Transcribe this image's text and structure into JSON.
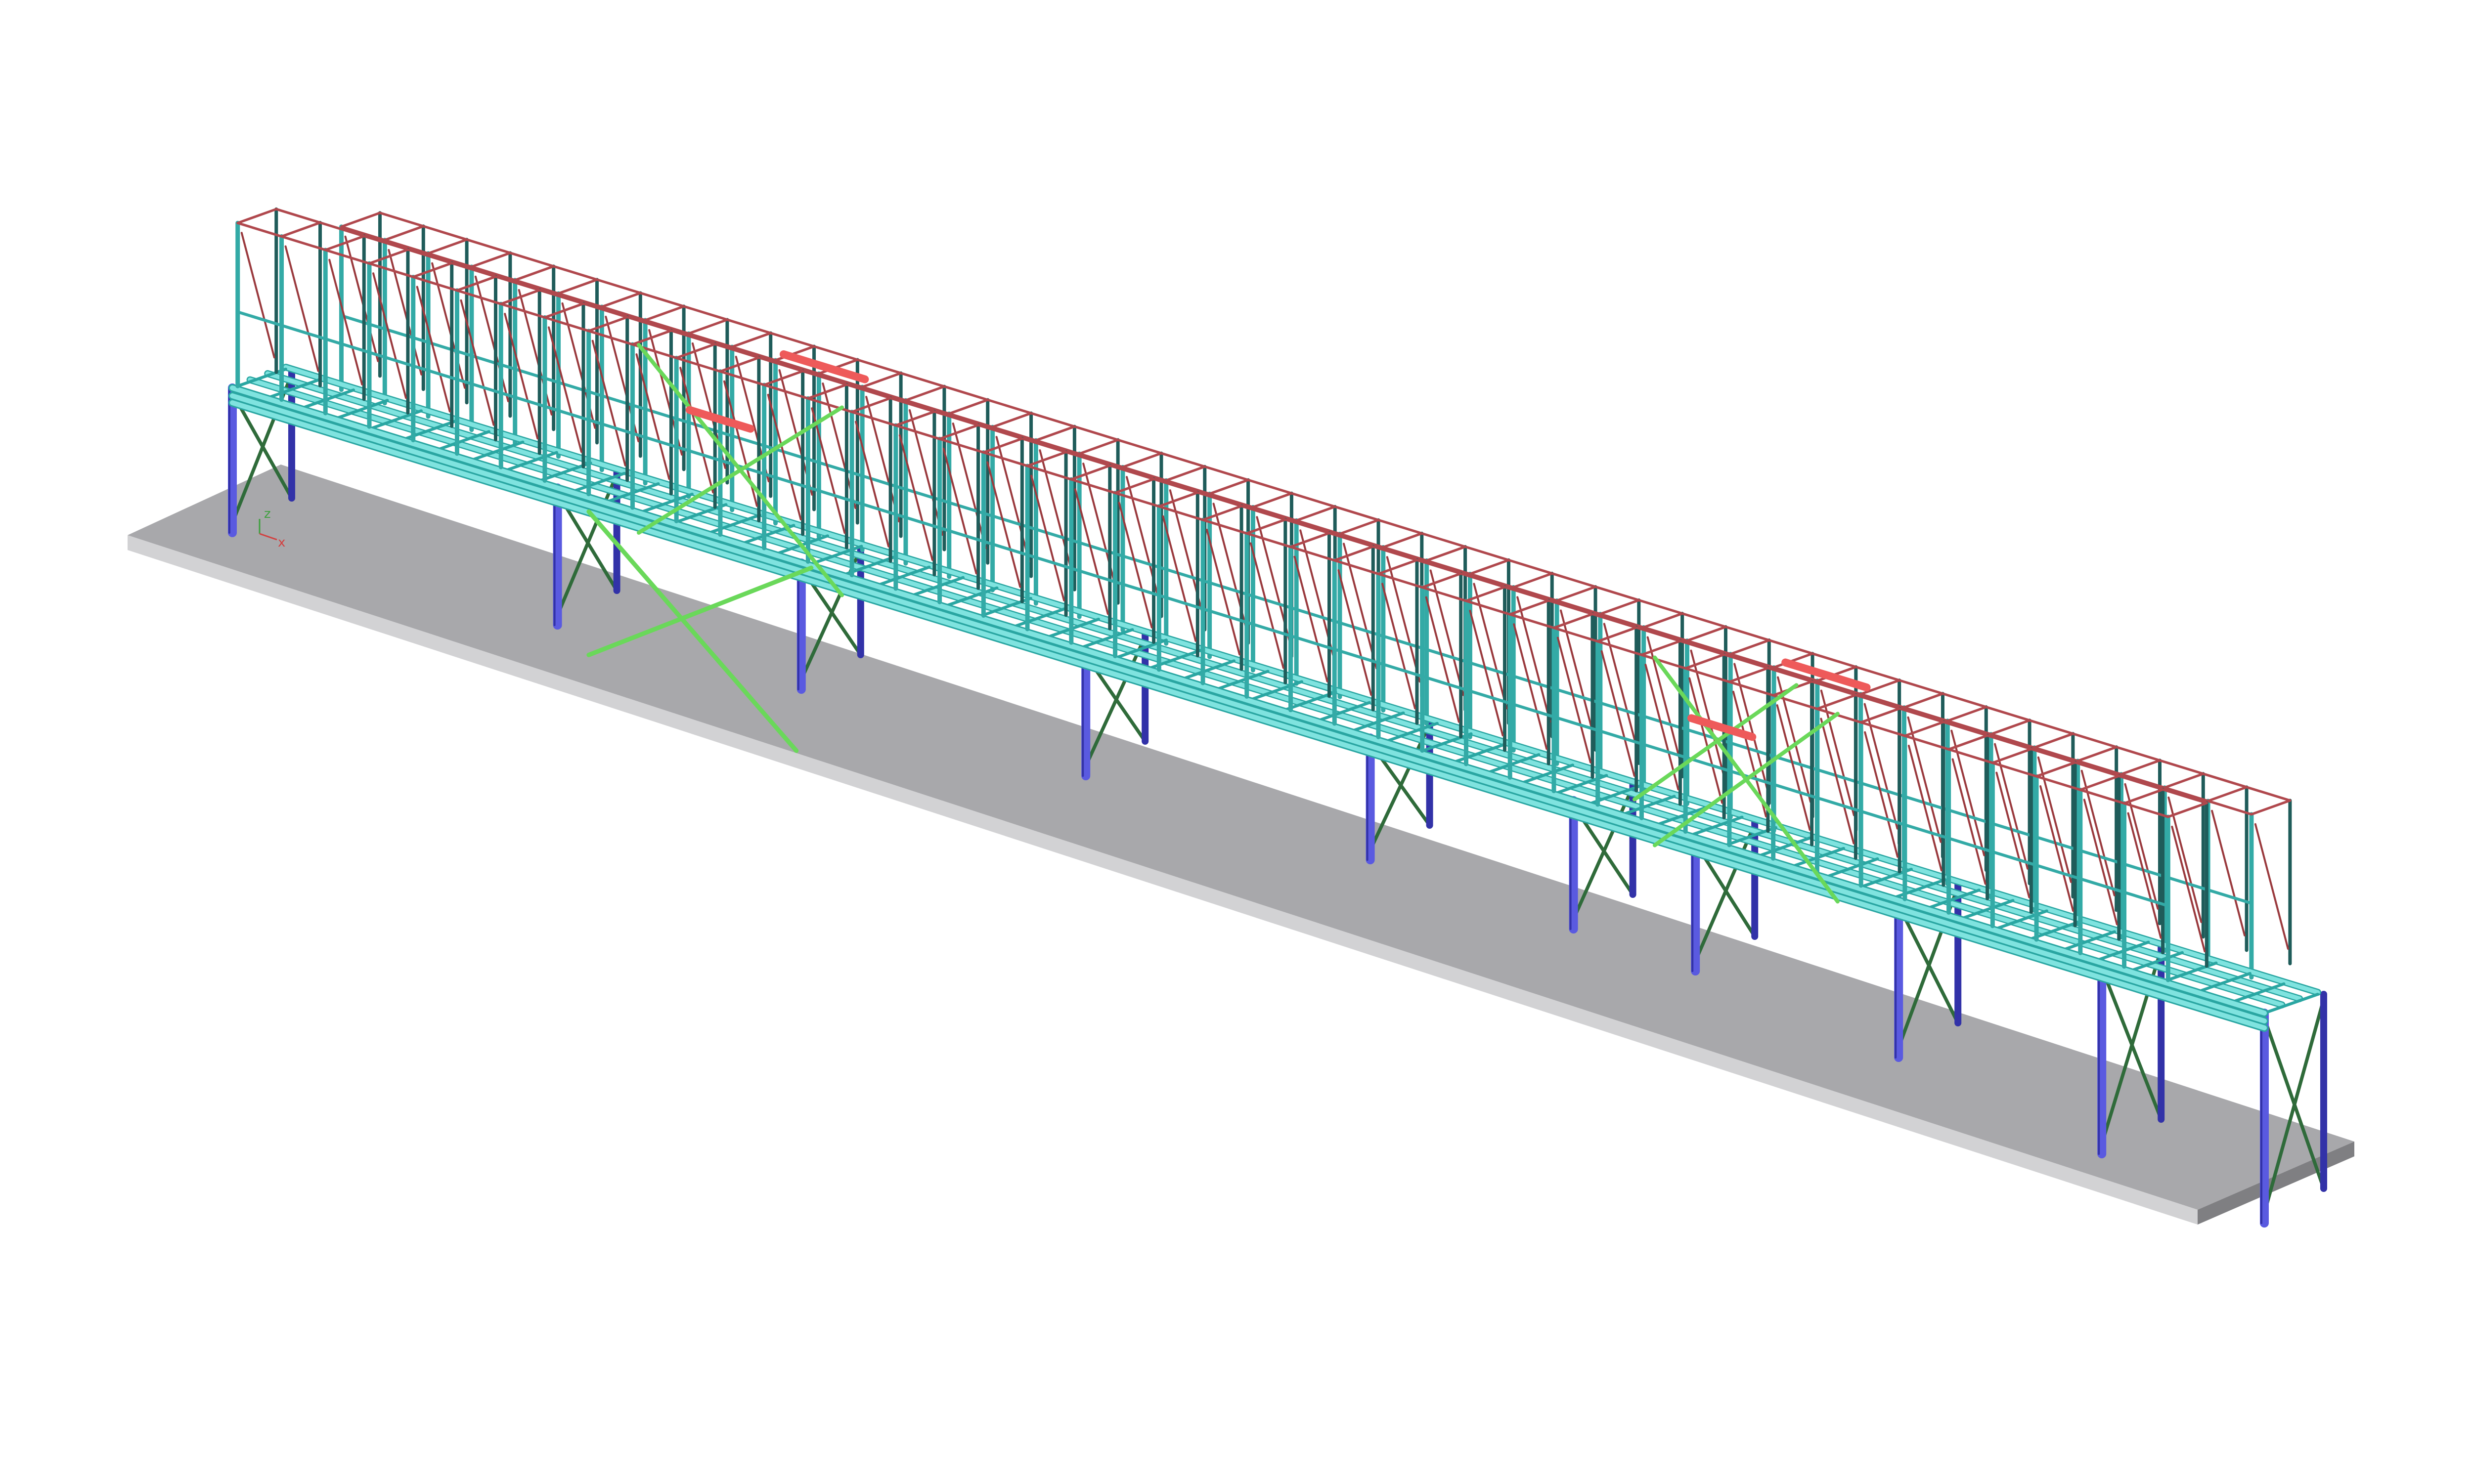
{
  "scene": {
    "background": "#ffffff",
    "palette": {
      "slab_top": "#a8a8ab",
      "slab_side": "#d2d2d4",
      "slab_end": "#7f7f82",
      "column": "#5a5ae0",
      "column_dark": "#3232a8",
      "column_bracing": "#2f6b3a",
      "deck_beam": "#7fe3df",
      "deck_beam_edge": "#2aa6a2",
      "frame_post": "#33aaa6",
      "frame_post_dark": "#1f5c5a",
      "frame_top": "#b0484d",
      "frame_diagonal": "#9a3a3e",
      "highlight_beam": "#ee5a5a",
      "portal_bracing": "#6ad85a",
      "axis_x": "#d24040",
      "axis_z": "#40a040"
    },
    "axis_indicator": {
      "x_label": "x",
      "z_label": "z"
    }
  }
}
